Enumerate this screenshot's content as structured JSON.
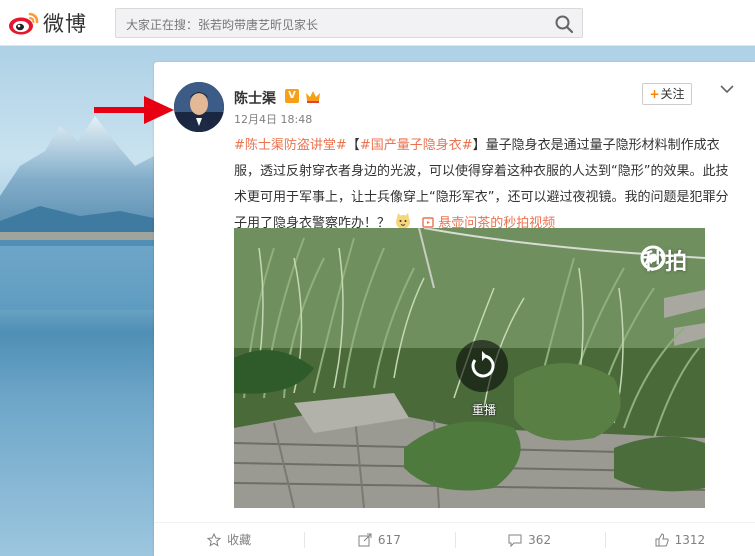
{
  "site": {
    "logo_text": "微博"
  },
  "search": {
    "text": "大家正在搜：张若昀带唐艺昕见家长"
  },
  "post": {
    "username": "陈士渠",
    "verified_badge": "V",
    "time": "12月4日 18:48",
    "follow_label": "关注",
    "follow_plus": "+",
    "topic1": "#陈士渠防盗讲堂#",
    "topic2_bracket_open": "【",
    "topic2": "#国产量子隐身衣#",
    "topic2_bracket_close": "】",
    "body": "量子隐身衣是通过量子隐形材料制作成衣服，透过反射穿衣者身边的光波，可以使得穿着这种衣服的人达到“隐形”的效果。此技术更可用于军事上，让士兵像穿上“隐形军衣”，还可以避过夜视镜。我的问题是犯罪分子用了隐身衣警察咋办！？",
    "video_link": "悬壶问茶的秒拍视频"
  },
  "video": {
    "watermark": "秒拍",
    "replay_label": "重播"
  },
  "footer": {
    "favorite_label": "收藏",
    "repost_count": "617",
    "comment_count": "362",
    "like_count": "1312"
  },
  "colors": {
    "accent": "#eb7350",
    "follow_plus": "#ff8200",
    "arrow": "#e60012",
    "verified": "#f7a017"
  }
}
